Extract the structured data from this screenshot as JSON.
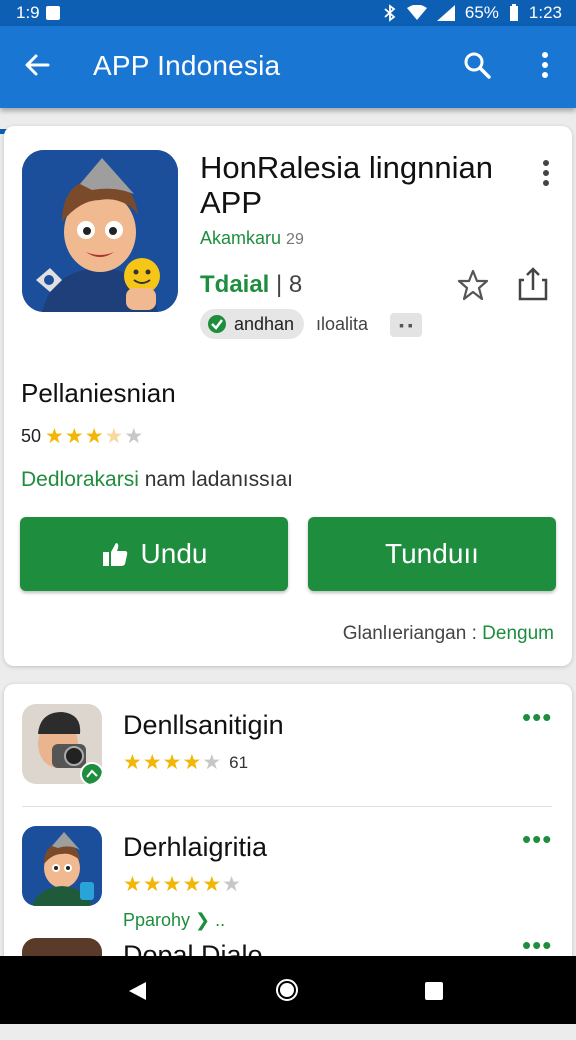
{
  "status_bar": {
    "left_text": "1:9",
    "battery": "65%",
    "time": "1:23"
  },
  "app_bar": {
    "title": "APP Indonesia"
  },
  "app": {
    "title": "HonRalesia lingnnian APP",
    "developer": "Akamkaru",
    "developer_suffix": "29",
    "rating_label": "Tdaial",
    "rating_suffix": "| 8",
    "chip_label": "andhan",
    "chip_extra": "ıloalita",
    "chip_mini": "▪ ▪"
  },
  "section": {
    "title": "Pellaniesnian",
    "rating_value": "50",
    "description_green": "Dedlorakarsi",
    "description_rest": " nam ladanıssıaı",
    "install_label": "Undu",
    "open_label": "Tunduıı",
    "footer_text": "Glanlıeriangan",
    "footer_sep": " : ",
    "footer_link": "Dengum"
  },
  "list": [
    {
      "title": "Denllsanitigin",
      "rating_value": "61",
      "subtitle": ""
    },
    {
      "title": "Derhlaigritia",
      "rating_value": "",
      "subtitle": "Pparohy ❯ .."
    },
    {
      "title": "Dopal Dialo",
      "rating_value": "",
      "subtitle": ""
    }
  ],
  "colors": {
    "primary": "#1976d2",
    "status": "#0d5fb4",
    "accent": "#1e8e3e",
    "star": "#f2b705"
  },
  "icons": [
    "back-arrow-icon",
    "search-icon",
    "more-vert-icon",
    "star-outline-icon",
    "share-icon",
    "thumbs-up-icon",
    "nav-back-icon",
    "nav-home-icon",
    "nav-recents-icon"
  ]
}
